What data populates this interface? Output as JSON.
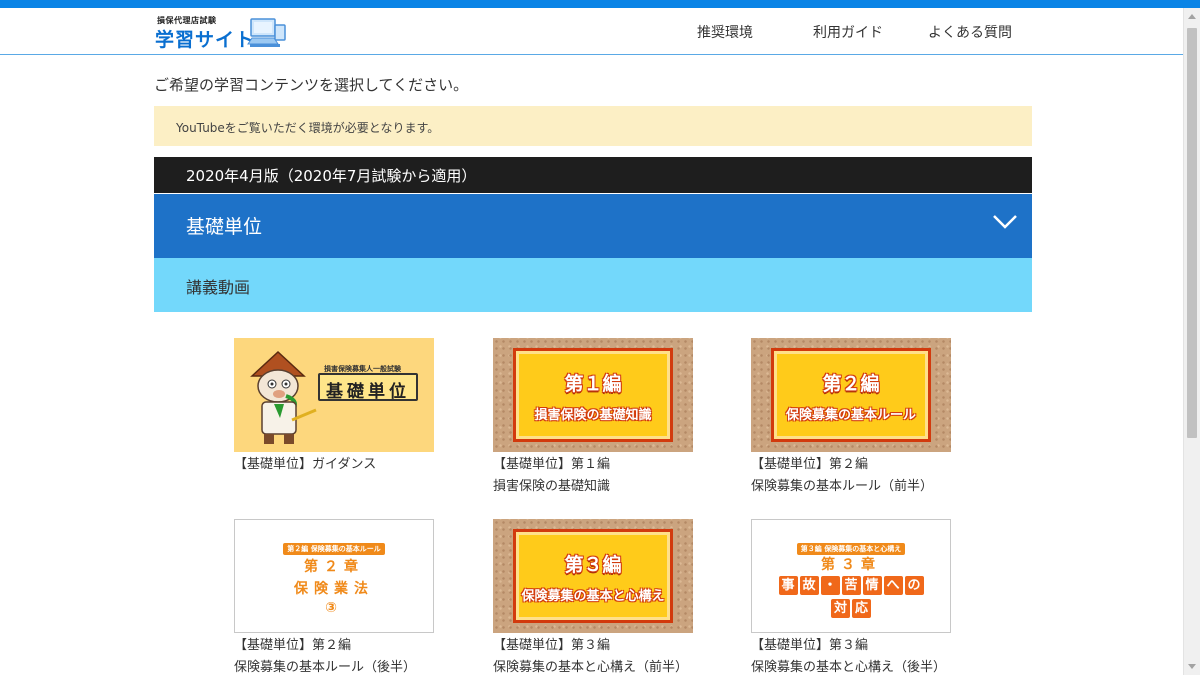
{
  "header": {
    "logo_small": "損保代理店試験",
    "logo_big": "学習サイト",
    "nav": [
      "推奨環境",
      "利用ガイド",
      "よくある質問"
    ]
  },
  "intro": "ご希望の学習コンテンツを選択してください。",
  "notice": "YouTubeをご覧いただく環境が必要となります。",
  "edition": "2020年4月版（2020年7月試験から適用）",
  "unit_title": "基礎単位",
  "section_title": "講義動画",
  "videos": [
    {
      "line1": "【基礎単位】ガイダンス",
      "line2": "",
      "thumb_small": "損害保険募集人一般試験",
      "thumb_title": "基礎単位"
    },
    {
      "line1": "【基礎単位】第１編",
      "line2": "損害保険の基礎知識",
      "thumb_title": "第１編",
      "thumb_sub": "損害保険の基礎知識"
    },
    {
      "line1": "【基礎単位】第２編",
      "line2": "保険募集の基本ルール（前半）",
      "thumb_title": "第２編",
      "thumb_sub": "保険募集の基本ルール"
    },
    {
      "line1": "【基礎単位】第２編",
      "line2": "保険募集の基本ルール（後半）",
      "thumb_tag": "第２編 保険募集の基本ルール",
      "thumb_l1": "第２章",
      "thumb_l2": "保険業法",
      "thumb_l3": "③"
    },
    {
      "line1": "【基礎単位】第３編",
      "line2": "保険募集の基本と心構え（前半）",
      "thumb_title": "第３編",
      "thumb_sub": "保険募集の基本と心構え"
    },
    {
      "line1": "【基礎単位】第３編",
      "line2": "保険募集の基本と心構え（後半）",
      "thumb_tag": "第３編 保険募集の基本と心構え",
      "thumb_l1": "第３章",
      "thumb_r1": [
        "事",
        "故",
        "・",
        "苦",
        "情",
        "へ",
        "の"
      ],
      "thumb_r2": [
        "対",
        "応"
      ]
    }
  ],
  "colors": {
    "accent": "#0a84e6",
    "unit_bar": "#1e72c8",
    "section_bar": "#73d8fb",
    "notice_bg": "#fcefc5"
  }
}
